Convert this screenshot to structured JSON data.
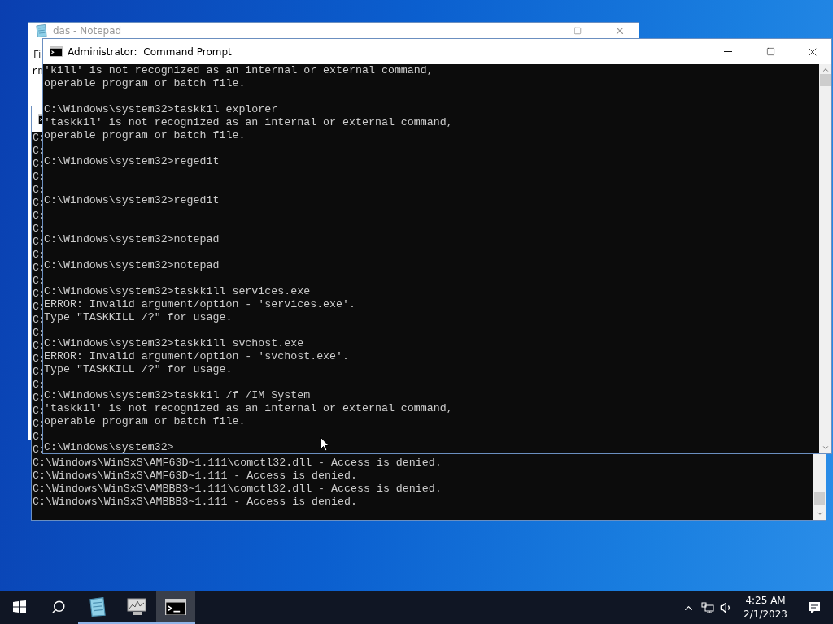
{
  "notepad": {
    "title": "das - Notepad",
    "menu": [
      "Fi"
    ],
    "text": "rm"
  },
  "background_console": {
    "lines": "C:\nC:\nC:\nC:\nC:\nC:\nC:\nC:\nC:\nC:\nC:\nC:\nC:\nC:\nC:\nC:\nC:\nC:\nC:\nC:\nC:\nC:\nC:\nC:\nC:\nC:\\Windows\\WinSxS\\AMF63D~1.111\\comctl32.dll - Access is denied.\nC:\\Windows\\WinSxS\\AMF63D~1.111 - Access is denied.\nC:\\Windows\\WinSxS\\AMBBB3~1.111\\comctl32.dll - Access is denied.\nC:\\Windows\\WinSxS\\AMBBB3~1.111 - Access is denied."
  },
  "command_prompt": {
    "title": "Administrator:  Command Prompt",
    "lines": "'kill' is not recognized as an internal or external command,\noperable program or batch file.\n\nC:\\Windows\\system32>taskkil explorer\n'taskkil' is not recognized as an internal or external command,\noperable program or batch file.\n\nC:\\Windows\\system32>regedit\n\n\nC:\\Windows\\system32>regedit\n\n\nC:\\Windows\\system32>notepad\n\nC:\\Windows\\system32>notepad\n\nC:\\Windows\\system32>taskkill services.exe\nERROR: Invalid argument/option - 'services.exe'.\nType \"TASKKILL /?\" for usage.\n\nC:\\Windows\\system32>taskkill svchost.exe\nERROR: Invalid argument/option - 'svchost.exe'.\nType \"TASKKILL /?\" for usage.\n\nC:\\Windows\\system32>taskkil /f /IM System\n'taskkil' is not recognized as an internal or external command,\noperable program or batch file.\n\nC:\\Windows\\system32>"
  },
  "taskbar": {
    "apps": [
      {
        "kind": "notepad",
        "selected": false
      },
      {
        "kind": "monitor",
        "selected": false
      },
      {
        "kind": "console",
        "selected": true
      }
    ],
    "clock": {
      "time": "4:25 AM",
      "date": "2/1/2023"
    }
  }
}
